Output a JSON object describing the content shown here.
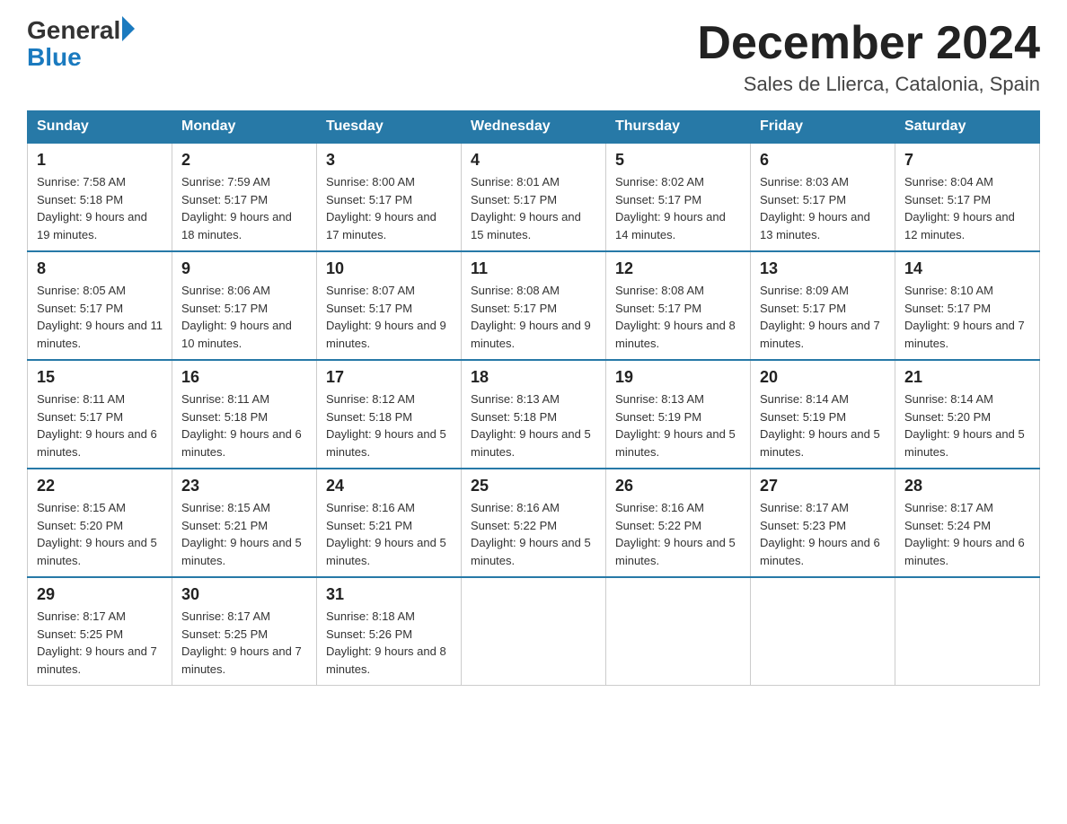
{
  "header": {
    "logo_general": "General",
    "logo_blue": "Blue",
    "month_title": "December 2024",
    "subtitle": "Sales de Llierca, Catalonia, Spain"
  },
  "days_of_week": [
    "Sunday",
    "Monday",
    "Tuesday",
    "Wednesday",
    "Thursday",
    "Friday",
    "Saturday"
  ],
  "weeks": [
    [
      {
        "day": "1",
        "sunrise": "7:58 AM",
        "sunset": "5:18 PM",
        "daylight": "9 hours and 19 minutes."
      },
      {
        "day": "2",
        "sunrise": "7:59 AM",
        "sunset": "5:17 PM",
        "daylight": "9 hours and 18 minutes."
      },
      {
        "day": "3",
        "sunrise": "8:00 AM",
        "sunset": "5:17 PM",
        "daylight": "9 hours and 17 minutes."
      },
      {
        "day": "4",
        "sunrise": "8:01 AM",
        "sunset": "5:17 PM",
        "daylight": "9 hours and 15 minutes."
      },
      {
        "day": "5",
        "sunrise": "8:02 AM",
        "sunset": "5:17 PM",
        "daylight": "9 hours and 14 minutes."
      },
      {
        "day": "6",
        "sunrise": "8:03 AM",
        "sunset": "5:17 PM",
        "daylight": "9 hours and 13 minutes."
      },
      {
        "day": "7",
        "sunrise": "8:04 AM",
        "sunset": "5:17 PM",
        "daylight": "9 hours and 12 minutes."
      }
    ],
    [
      {
        "day": "8",
        "sunrise": "8:05 AM",
        "sunset": "5:17 PM",
        "daylight": "9 hours and 11 minutes."
      },
      {
        "day": "9",
        "sunrise": "8:06 AM",
        "sunset": "5:17 PM",
        "daylight": "9 hours and 10 minutes."
      },
      {
        "day": "10",
        "sunrise": "8:07 AM",
        "sunset": "5:17 PM",
        "daylight": "9 hours and 9 minutes."
      },
      {
        "day": "11",
        "sunrise": "8:08 AM",
        "sunset": "5:17 PM",
        "daylight": "9 hours and 9 minutes."
      },
      {
        "day": "12",
        "sunrise": "8:08 AM",
        "sunset": "5:17 PM",
        "daylight": "9 hours and 8 minutes."
      },
      {
        "day": "13",
        "sunrise": "8:09 AM",
        "sunset": "5:17 PM",
        "daylight": "9 hours and 7 minutes."
      },
      {
        "day": "14",
        "sunrise": "8:10 AM",
        "sunset": "5:17 PM",
        "daylight": "9 hours and 7 minutes."
      }
    ],
    [
      {
        "day": "15",
        "sunrise": "8:11 AM",
        "sunset": "5:17 PM",
        "daylight": "9 hours and 6 minutes."
      },
      {
        "day": "16",
        "sunrise": "8:11 AM",
        "sunset": "5:18 PM",
        "daylight": "9 hours and 6 minutes."
      },
      {
        "day": "17",
        "sunrise": "8:12 AM",
        "sunset": "5:18 PM",
        "daylight": "9 hours and 5 minutes."
      },
      {
        "day": "18",
        "sunrise": "8:13 AM",
        "sunset": "5:18 PM",
        "daylight": "9 hours and 5 minutes."
      },
      {
        "day": "19",
        "sunrise": "8:13 AM",
        "sunset": "5:19 PM",
        "daylight": "9 hours and 5 minutes."
      },
      {
        "day": "20",
        "sunrise": "8:14 AM",
        "sunset": "5:19 PM",
        "daylight": "9 hours and 5 minutes."
      },
      {
        "day": "21",
        "sunrise": "8:14 AM",
        "sunset": "5:20 PM",
        "daylight": "9 hours and 5 minutes."
      }
    ],
    [
      {
        "day": "22",
        "sunrise": "8:15 AM",
        "sunset": "5:20 PM",
        "daylight": "9 hours and 5 minutes."
      },
      {
        "day": "23",
        "sunrise": "8:15 AM",
        "sunset": "5:21 PM",
        "daylight": "9 hours and 5 minutes."
      },
      {
        "day": "24",
        "sunrise": "8:16 AM",
        "sunset": "5:21 PM",
        "daylight": "9 hours and 5 minutes."
      },
      {
        "day": "25",
        "sunrise": "8:16 AM",
        "sunset": "5:22 PM",
        "daylight": "9 hours and 5 minutes."
      },
      {
        "day": "26",
        "sunrise": "8:16 AM",
        "sunset": "5:22 PM",
        "daylight": "9 hours and 5 minutes."
      },
      {
        "day": "27",
        "sunrise": "8:17 AM",
        "sunset": "5:23 PM",
        "daylight": "9 hours and 6 minutes."
      },
      {
        "day": "28",
        "sunrise": "8:17 AM",
        "sunset": "5:24 PM",
        "daylight": "9 hours and 6 minutes."
      }
    ],
    [
      {
        "day": "29",
        "sunrise": "8:17 AM",
        "sunset": "5:25 PM",
        "daylight": "9 hours and 7 minutes."
      },
      {
        "day": "30",
        "sunrise": "8:17 AM",
        "sunset": "5:25 PM",
        "daylight": "9 hours and 7 minutes."
      },
      {
        "day": "31",
        "sunrise": "8:18 AM",
        "sunset": "5:26 PM",
        "daylight": "9 hours and 8 minutes."
      },
      null,
      null,
      null,
      null
    ]
  ]
}
